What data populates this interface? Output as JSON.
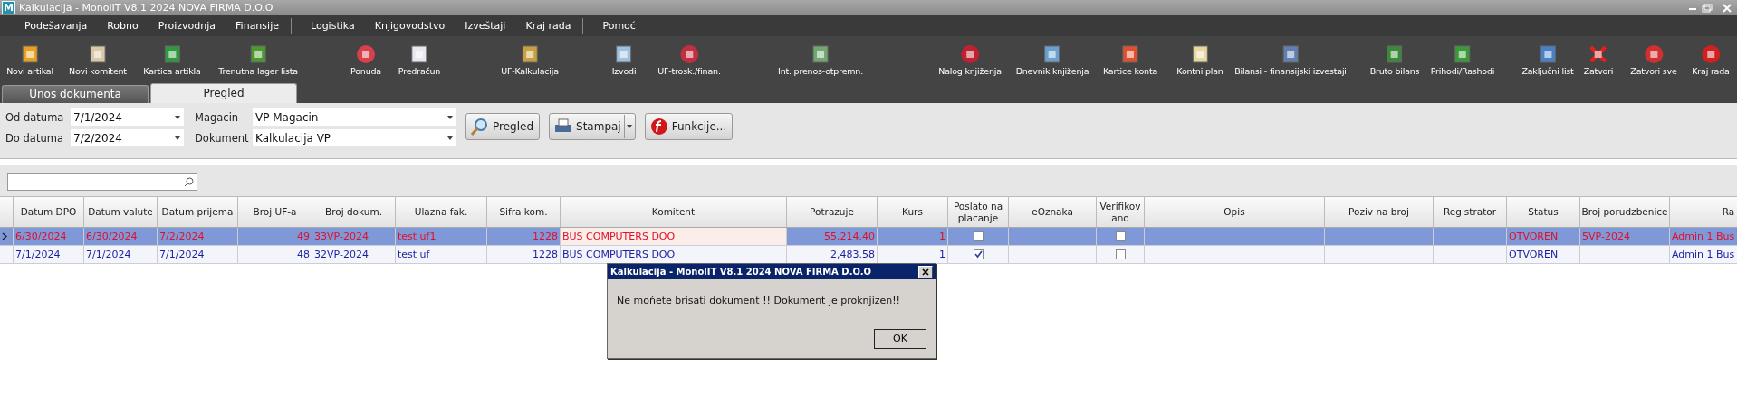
{
  "window": {
    "title": "Kalkulacija - MonolIT V8.1 2024 NOVA FIRMA D.O.O",
    "logo": "M"
  },
  "menu": [
    "Podešavanja",
    "Robno",
    "Proizvodnja",
    "Finansije",
    "Logistika",
    "Knjigovodstvo",
    "Izveštaji",
    "Kraj rada",
    "Pomoć"
  ],
  "toolbar": [
    "Novi artikal",
    "Novi komitent",
    "Kartica artikla",
    "Trenutna lager lista",
    "Ponuda",
    "Predračun",
    "UF-Kalkulacija",
    "Izvodi",
    "UF-trosk./finan.",
    "Int. prenos-otpremn.",
    "Nalog knjiženja",
    "Dnevnik knjiženja",
    "Kartice konta",
    "Kontni plan",
    "Bilansi - finansijski izvestaji",
    "Bruto bilans",
    "Prihodi/Rashodi",
    "Zaključni list",
    "Zatvori",
    "Zatvori sve",
    "Kraj rada"
  ],
  "tabs": [
    {
      "label": "Unos dokumenta",
      "selected": false
    },
    {
      "label": "Pregled",
      "selected": true
    }
  ],
  "filters": [
    {
      "label": "Od datuma",
      "value": "7/1/2024"
    },
    {
      "label": "Do datuma",
      "value": "7/2/2024"
    },
    {
      "label": "Magacin",
      "value": "VP Magacin"
    },
    {
      "label": "Dokument",
      "value": "Kalkulacija VP"
    }
  ],
  "actions": [
    {
      "label": "Pregled",
      "kind": "plain"
    },
    {
      "label": "Stampaj",
      "kind": "split"
    },
    {
      "label": "Funkcije...",
      "kind": "plain"
    }
  ],
  "columns": [
    {
      "label": "Datum DPO",
      "kind": "text"
    },
    {
      "label": "Datum valute",
      "kind": "text"
    },
    {
      "label": "Datum prijema",
      "kind": "text"
    },
    {
      "label": "Broj UF-a",
      "kind": "text"
    },
    {
      "label": "Broj dokum.",
      "kind": "text"
    },
    {
      "label": "Ulazna fak.",
      "kind": "text"
    },
    {
      "label": "Sifra kom.",
      "kind": "text"
    },
    {
      "label": "Komitent",
      "kind": "text"
    },
    {
      "label": "Potrazuje",
      "kind": "text"
    },
    {
      "label": "Kurs",
      "kind": "text"
    },
    {
      "label": "Poslato na placanje",
      "kind": "check"
    },
    {
      "label": "eOznaka",
      "kind": "text"
    },
    {
      "label": "Verifikovano",
      "kind": "check"
    },
    {
      "label": "Opis",
      "kind": "text"
    },
    {
      "label": "Poziv na broj",
      "kind": "text"
    },
    {
      "label": "Registrator",
      "kind": "text"
    },
    {
      "label": "Status",
      "kind": "text"
    },
    {
      "label": "Broj porudzbenice",
      "kind": "text"
    },
    {
      "label": "Ra",
      "kind": "text"
    }
  ],
  "rows": [
    {
      "selected": true,
      "cells": [
        {
          "text": "6/30/2024"
        },
        {
          "text": "6/30/2024"
        },
        {
          "text": "7/2/2024"
        },
        {
          "text": "49"
        },
        {
          "text": "33VP-2024"
        },
        {
          "text": "test uf1"
        },
        {
          "text": "1228"
        },
        {
          "text": "BUS COMPUTERS DOO",
          "focused": true
        },
        {
          "text": "55,214.40"
        },
        {
          "text": "1"
        },
        {
          "checked": false
        },
        {
          "text": ""
        },
        {
          "checked": false
        },
        {
          "text": ""
        },
        {
          "text": ""
        },
        {
          "text": ""
        },
        {
          "text": "OTVOREN"
        },
        {
          "text": "5VP-2024"
        },
        {
          "text": "Admin 1 Bus"
        }
      ]
    },
    {
      "selected": false,
      "cells": [
        {
          "text": "7/1/2024"
        },
        {
          "text": "7/1/2024"
        },
        {
          "text": "7/1/2024"
        },
        {
          "text": "48"
        },
        {
          "text": "32VP-2024"
        },
        {
          "text": "test uf"
        },
        {
          "text": "1228"
        },
        {
          "text": "BUS COMPUTERS DOO"
        },
        {
          "text": "2,483.58"
        },
        {
          "text": "1"
        },
        {
          "checked": true
        },
        {
          "text": ""
        },
        {
          "checked": false
        },
        {
          "text": ""
        },
        {
          "text": ""
        },
        {
          "text": ""
        },
        {
          "text": "OTVOREN"
        },
        {
          "text": ""
        },
        {
          "text": "Admin 1 Bus"
        }
      ]
    }
  ],
  "dialog": {
    "title": "Kalkulacija - MonolIT V8.1 2024 NOVA FIRMA D.O.O",
    "message": "Ne mońete brisati dokument !! Dokument je proknjizen!!",
    "button": "OK"
  }
}
